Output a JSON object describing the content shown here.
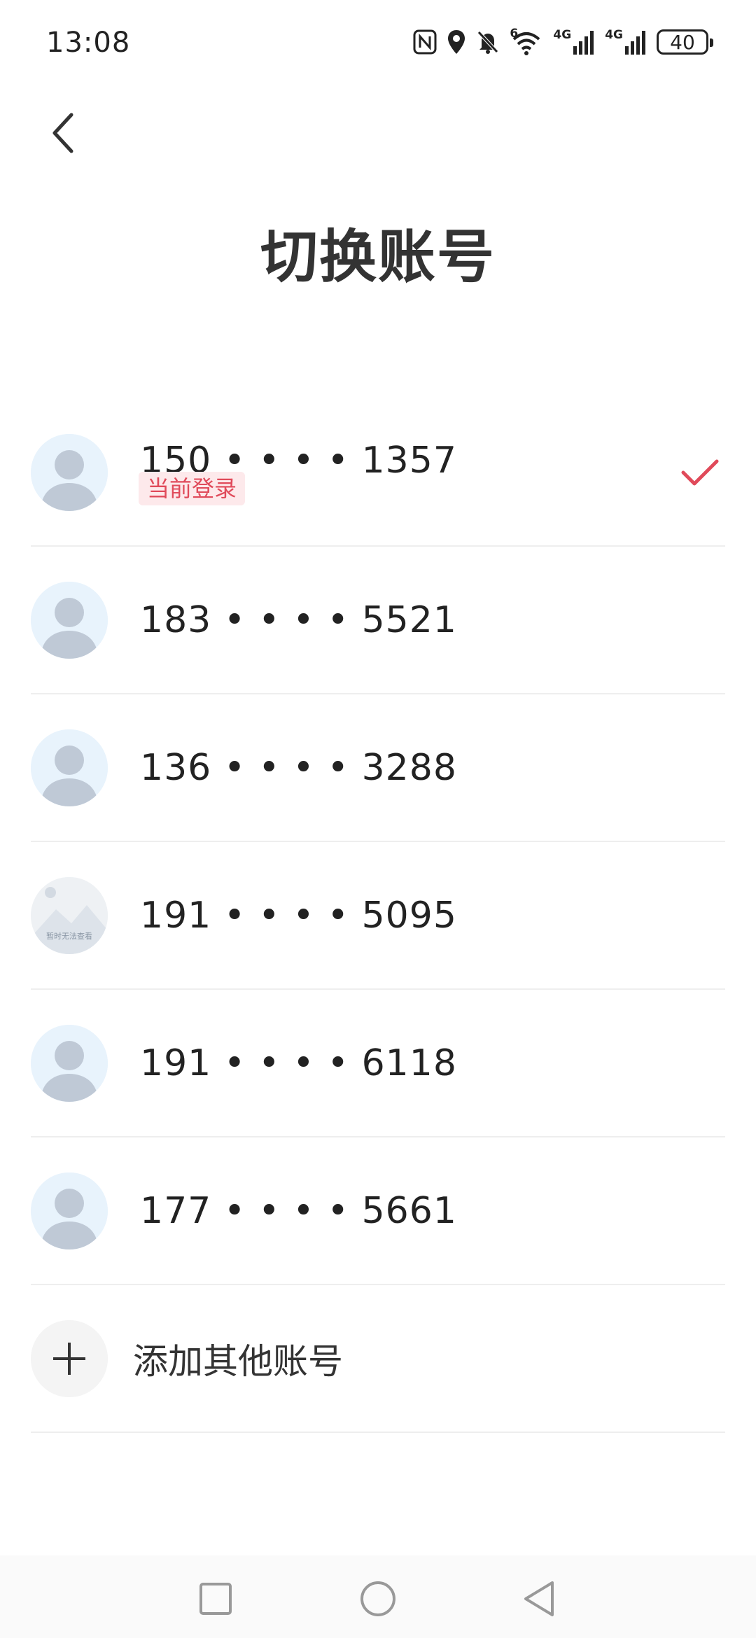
{
  "status_bar": {
    "time": "13:08",
    "network_1": "4G",
    "network_2": "4G",
    "wifi_badge": "6",
    "battery": "40"
  },
  "header": {
    "back_icon": "chevron-left-icon",
    "title": "切换账号"
  },
  "accounts": [
    {
      "number": "150 • • • • 1357",
      "badge": "当前登录",
      "avatar": "default-avatar-icon",
      "selected": true
    },
    {
      "number": "183 • • • • 5521",
      "avatar": "default-avatar-icon"
    },
    {
      "number": "136 • • • • 3288",
      "avatar": "default-avatar-icon"
    },
    {
      "number": "191 • • • • 5095",
      "avatar": "image-placeholder-icon",
      "avatar_caption": "暂时无法查看"
    },
    {
      "number": "191 • • • • 6118",
      "avatar": "default-avatar-icon"
    },
    {
      "number": "177 • • • • 5661",
      "avatar": "default-avatar-icon"
    }
  ],
  "add_account": {
    "label": "添加其他账号",
    "icon": "plus-icon"
  },
  "colors": {
    "accent": "#e04a5a",
    "badge_bg": "#fde9eb",
    "avatar_bg": "#e8f3fc",
    "avatar_figure": "#bfc9d6"
  },
  "nav": {
    "recent_icon": "square-icon",
    "home_icon": "circle-icon",
    "back_icon": "triangle-back-icon"
  }
}
